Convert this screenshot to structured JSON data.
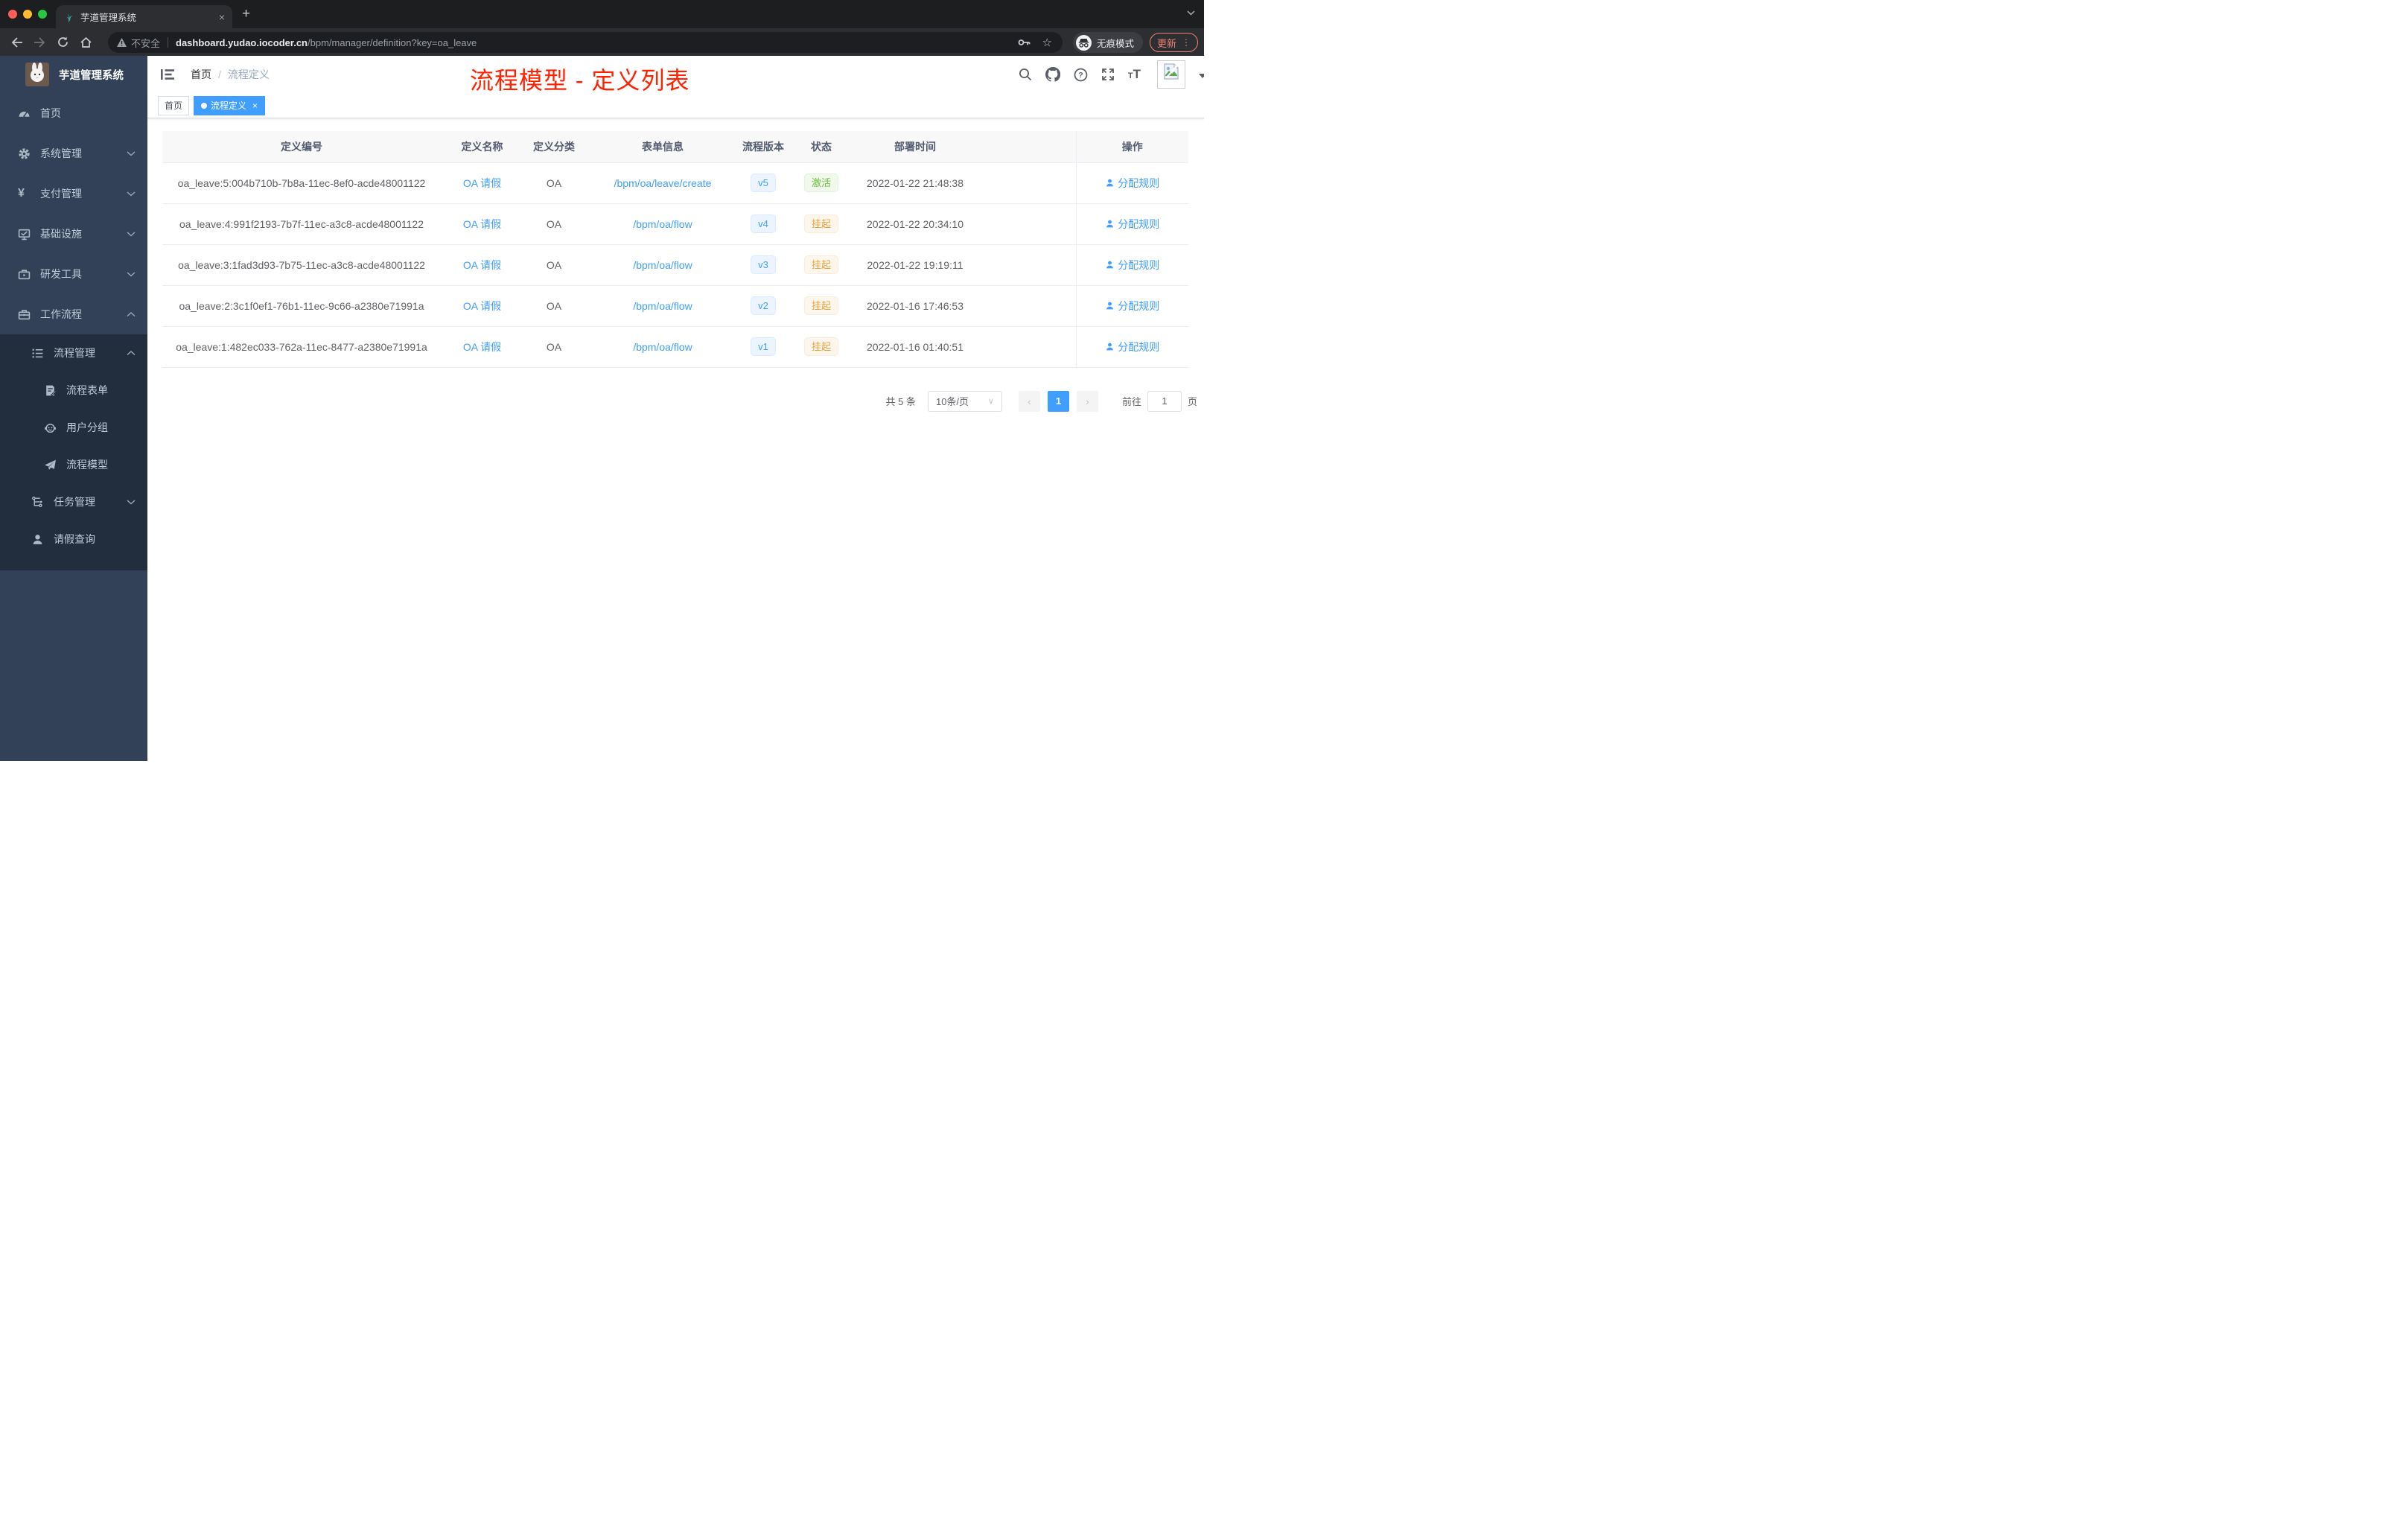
{
  "browser": {
    "tab_title": "芋道管理系统",
    "tab_close": "×",
    "new_tab_button": "+",
    "url_security": "不安全",
    "url_host": "dashboard.yudao.iocoder.cn",
    "url_path": "/bpm/manager/definition?key=oa_leave",
    "incognito_label": "无痕模式",
    "update_button": "更新",
    "update_dots": "⋮"
  },
  "sidebar": {
    "title": "芋道管理系统",
    "items": [
      {
        "label": "首页",
        "icon": "dashboard-icon"
      },
      {
        "label": "系统管理",
        "icon": "gear-icon"
      },
      {
        "label": "支付管理",
        "icon": "yen-icon"
      },
      {
        "label": "基础设施",
        "icon": "monitor-icon"
      },
      {
        "label": "研发工具",
        "icon": "toolbox-icon"
      },
      {
        "label": "工作流程",
        "icon": "briefcase-icon"
      },
      {
        "label": "流程管理",
        "icon": "list-icon"
      },
      {
        "label": "流程表单",
        "icon": "form-icon"
      },
      {
        "label": "用户分组",
        "icon": "robot-icon"
      },
      {
        "label": "流程模型",
        "icon": "paper-plane-icon"
      },
      {
        "label": "任务管理",
        "icon": "tree-icon"
      },
      {
        "label": "请假查询",
        "icon": "user-icon"
      }
    ]
  },
  "navbar": {
    "breadcrumb_home": "首页",
    "breadcrumb_separator": "/",
    "breadcrumb_current": "流程定义",
    "annotation": "流程模型 - 定义列表"
  },
  "tags_view": {
    "home_tag": "首页",
    "active_tag": "流程定义",
    "active_tag_close": "×"
  },
  "table": {
    "headers": [
      "定义编号",
      "定义名称",
      "定义分类",
      "表单信息",
      "流程版本",
      "状态",
      "部署时间",
      "操作"
    ],
    "rows": [
      {
        "id": "oa_leave:5:004b710b-7b8a-11ec-8ef0-acde48001122",
        "name": "OA 请假",
        "category": "OA",
        "form": "/bpm/oa/leave/create",
        "version": "v5",
        "status": "激活",
        "status_type": "success",
        "deployed_at": "2022-01-22 21:48:38",
        "action": "分配规则"
      },
      {
        "id": "oa_leave:4:991f2193-7b7f-11ec-a3c8-acde48001122",
        "name": "OA 请假",
        "category": "OA",
        "form": "/bpm/oa/flow",
        "version": "v4",
        "status": "挂起",
        "status_type": "warning",
        "deployed_at": "2022-01-22 20:34:10",
        "action": "分配规则"
      },
      {
        "id": "oa_leave:3:1fad3d93-7b75-11ec-a3c8-acde48001122",
        "name": "OA 请假",
        "category": "OA",
        "form": "/bpm/oa/flow",
        "version": "v3",
        "status": "挂起",
        "status_type": "warning",
        "deployed_at": "2022-01-22 19:19:11",
        "action": "分配规则"
      },
      {
        "id": "oa_leave:2:3c1f0ef1-76b1-11ec-9c66-a2380e71991a",
        "name": "OA 请假",
        "category": "OA",
        "form": "/bpm/oa/flow",
        "version": "v2",
        "status": "挂起",
        "status_type": "warning",
        "deployed_at": "2022-01-16 17:46:53",
        "action": "分配规则"
      },
      {
        "id": "oa_leave:1:482ec033-762a-11ec-8477-a2380e71991a",
        "name": "OA 请假",
        "category": "OA",
        "form": "/bpm/oa/flow",
        "version": "v1",
        "status": "挂起",
        "status_type": "warning",
        "deployed_at": "2022-01-16 01:40:51",
        "action": "分配规则"
      }
    ]
  },
  "pagination": {
    "total": "共 5 条",
    "page_size": "10条/页",
    "prev": "‹",
    "current_page": "1",
    "next": "›",
    "goto_label": "前往",
    "goto_value": "1",
    "page_unit": "页"
  },
  "colors": {
    "accent": "#409eff",
    "annotation_red": "#ff2200",
    "sidebar_bg": "#324157",
    "submenu_bg": "#222e3e",
    "status_active_text": "#67c23a",
    "status_suspended_text": "#e6a23c",
    "version_badge_text": "#409eff",
    "update_button_color": "#ee8277"
  }
}
